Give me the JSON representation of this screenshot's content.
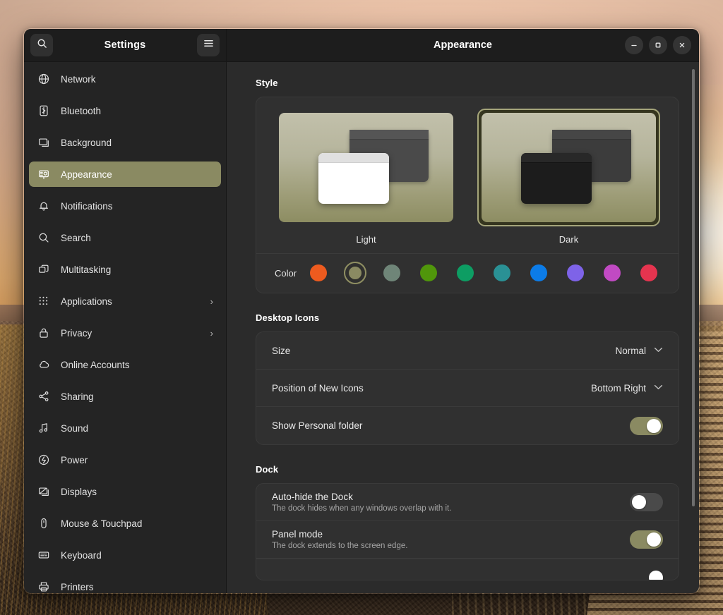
{
  "sidebar": {
    "title": "Settings",
    "search_icon": "search-icon",
    "menu_icon": "hamburger-menu-icon",
    "items": [
      {
        "label": "Network",
        "icon": "globe-icon",
        "selected": false,
        "chevron": ""
      },
      {
        "label": "Bluetooth",
        "icon": "bluetooth-icon",
        "selected": false,
        "chevron": ""
      },
      {
        "label": "Background",
        "icon": "monitor-icon",
        "selected": false,
        "chevron": ""
      },
      {
        "label": "Appearance",
        "icon": "appearance-icon",
        "selected": true,
        "chevron": ""
      },
      {
        "label": "Notifications",
        "icon": "bell-icon",
        "selected": false,
        "chevron": ""
      },
      {
        "label": "Search",
        "icon": "search-icon",
        "selected": false,
        "chevron": ""
      },
      {
        "label": "Multitasking",
        "icon": "windows-icon",
        "selected": false,
        "chevron": ""
      },
      {
        "label": "Applications",
        "icon": "grid-dots-icon",
        "selected": false,
        "chevron": "›"
      },
      {
        "label": "Privacy",
        "icon": "lock-icon",
        "selected": false,
        "chevron": "›"
      },
      {
        "label": "Online Accounts",
        "icon": "cloud-icon",
        "selected": false,
        "chevron": ""
      },
      {
        "label": "Sharing",
        "icon": "share-nodes-icon",
        "selected": false,
        "chevron": ""
      },
      {
        "label": "Sound",
        "icon": "music-note-icon",
        "selected": false,
        "chevron": ""
      },
      {
        "label": "Power",
        "icon": "power-icon",
        "selected": false,
        "chevron": ""
      },
      {
        "label": "Displays",
        "icon": "displays-icon",
        "selected": false,
        "chevron": ""
      },
      {
        "label": "Mouse & Touchpad",
        "icon": "mouse-icon",
        "selected": false,
        "chevron": ""
      },
      {
        "label": "Keyboard",
        "icon": "keyboard-icon",
        "selected": false,
        "chevron": ""
      },
      {
        "label": "Printers",
        "icon": "printer-icon",
        "selected": false,
        "chevron": ""
      }
    ]
  },
  "titlebar": {
    "title": "Appearance",
    "minimize_label": "–",
    "maximize_label": "□",
    "close_label": "✕"
  },
  "style": {
    "heading": "Style",
    "choices": [
      {
        "label": "Light",
        "selected": false
      },
      {
        "label": "Dark",
        "selected": true
      }
    ],
    "color_label": "Color",
    "accent_selected_index": 1,
    "colors": [
      {
        "name": "orange",
        "hex": "#ed5b1f",
        "selected": false
      },
      {
        "name": "olive",
        "hex": "#8a8a62",
        "selected": true
      },
      {
        "name": "sage",
        "hex": "#6f8578",
        "selected": false
      },
      {
        "name": "green",
        "hex": "#50960b",
        "selected": false
      },
      {
        "name": "emerald",
        "hex": "#0d9d63",
        "selected": false
      },
      {
        "name": "teal",
        "hex": "#2a9195",
        "selected": false
      },
      {
        "name": "blue",
        "hex": "#0c7ce8",
        "selected": false
      },
      {
        "name": "purple",
        "hex": "#7e63e8",
        "selected": false
      },
      {
        "name": "magenta",
        "hex": "#c14ac3",
        "selected": false
      },
      {
        "name": "red",
        "hex": "#e5344f",
        "selected": false
      }
    ]
  },
  "desktop_icons": {
    "heading": "Desktop Icons",
    "rows": [
      {
        "title": "Size",
        "sub": "",
        "kind": "select",
        "value": "Normal",
        "chevron": "⌄"
      },
      {
        "title": "Position of New Icons",
        "sub": "",
        "kind": "select",
        "value": "Bottom Right",
        "chevron": "⌄"
      },
      {
        "title": "Show Personal folder",
        "sub": "",
        "kind": "toggle",
        "on": true
      }
    ]
  },
  "dock": {
    "heading": "Dock",
    "rows": [
      {
        "title": "Auto-hide the Dock",
        "sub": "The dock hides when any windows overlap with it.",
        "kind": "toggle",
        "on": false
      },
      {
        "title": "Panel mode",
        "sub": "The dock extends to the screen edge.",
        "kind": "toggle",
        "on": true
      }
    ]
  }
}
